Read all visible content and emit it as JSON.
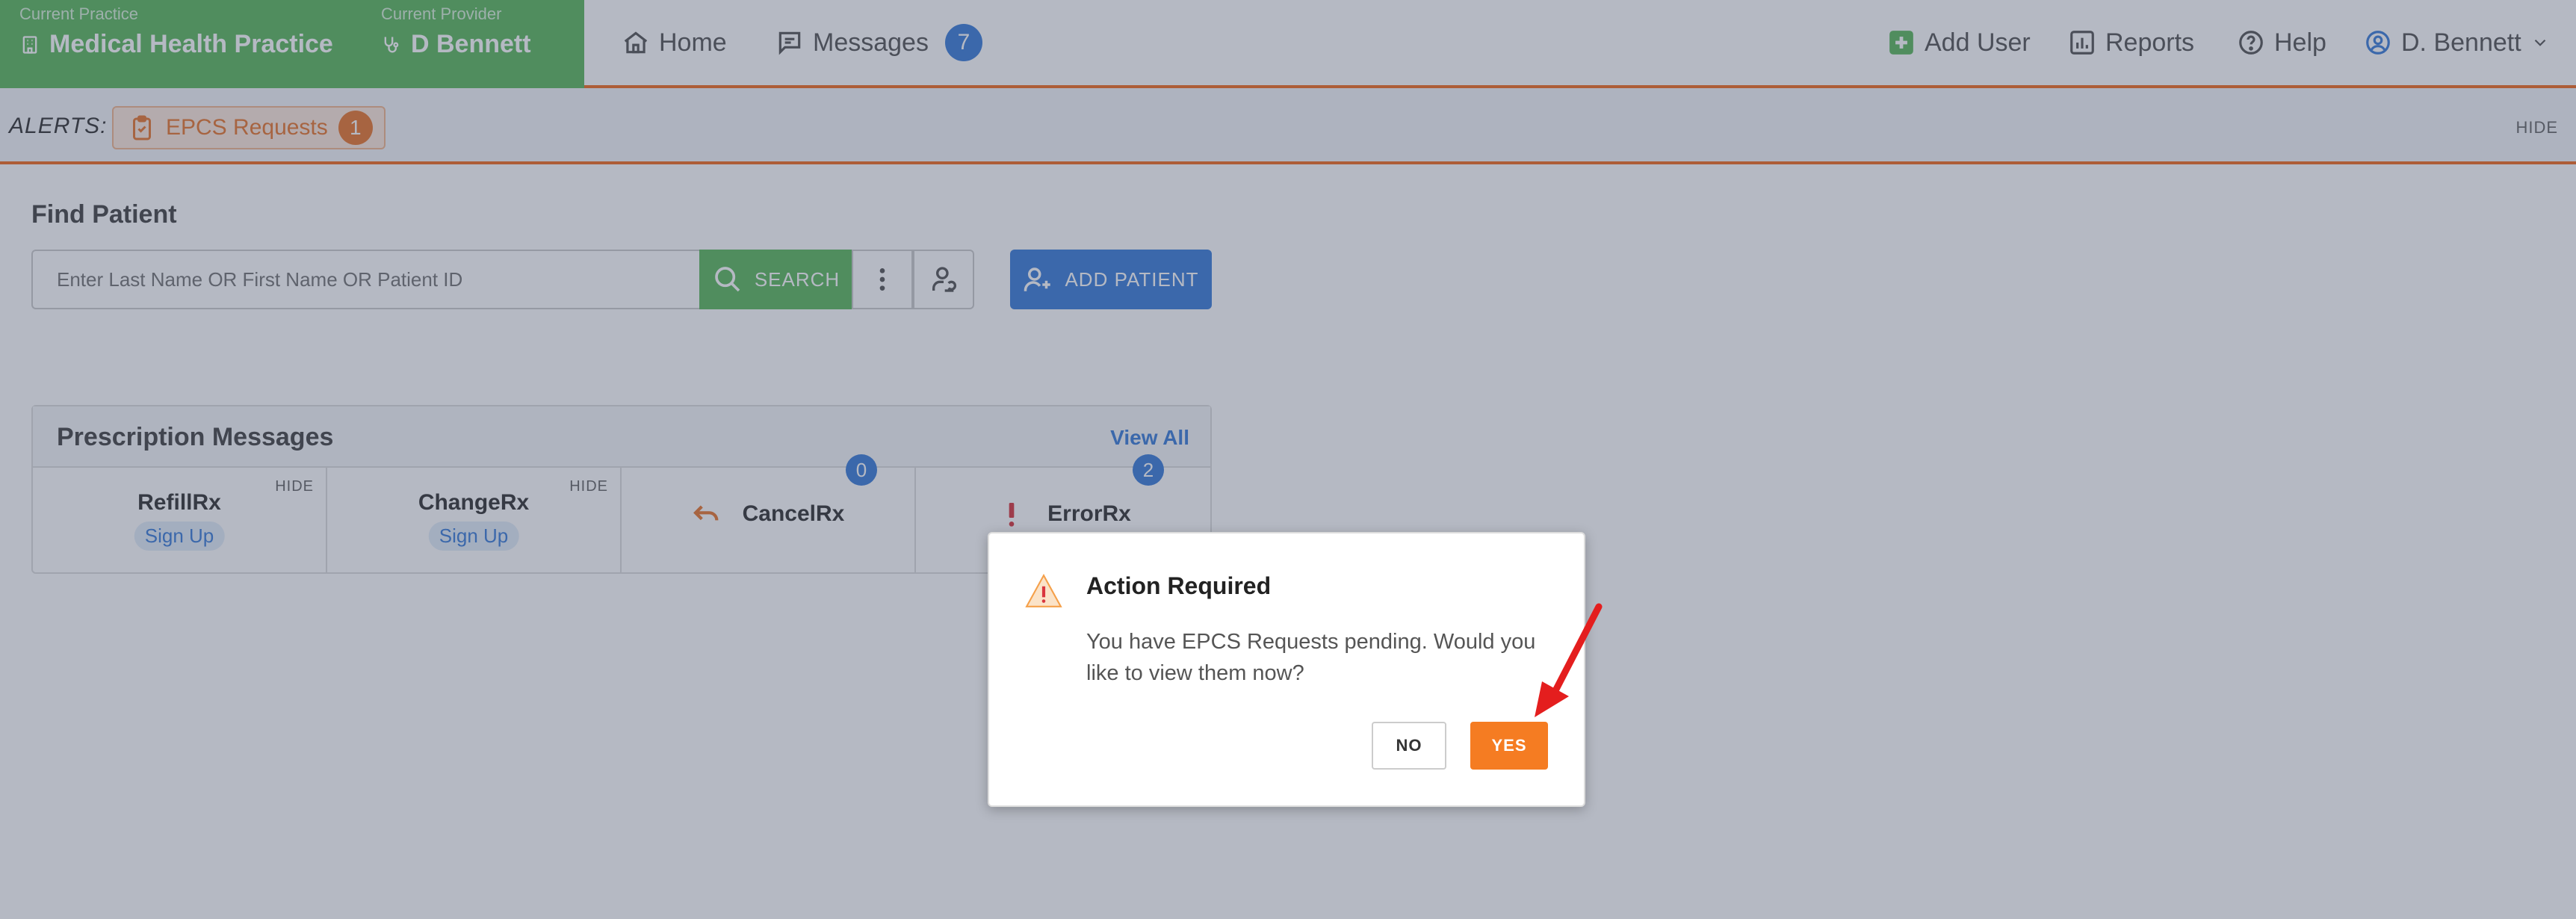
{
  "topnav": {
    "practice_label": "Current Practice",
    "practice_value": "Medical Health Practice",
    "provider_label": "Current Provider",
    "provider_value": "D Bennett",
    "home": "Home",
    "messages": "Messages",
    "messages_count": "7",
    "add_user": "Add User",
    "reports": "Reports",
    "help": "Help",
    "user": "D. Bennett"
  },
  "alerts": {
    "label": "ALERTS:",
    "epcs_label": "EPCS Requests",
    "epcs_count": "1",
    "hide": "HIDE"
  },
  "find_patient": {
    "title": "Find Patient",
    "placeholder": "Enter Last Name OR First Name OR Patient ID",
    "search_label": "SEARCH",
    "add_patient_label": "ADD PATIENT"
  },
  "rx_messages": {
    "title": "Prescription Messages",
    "view_all": "View All",
    "refill": {
      "name": "RefillRx",
      "sub": "Sign Up",
      "hide": "HIDE"
    },
    "change": {
      "name": "ChangeRx",
      "sub": "Sign Up",
      "hide": "HIDE"
    },
    "cancel": {
      "name": "CancelRx",
      "count": "0"
    },
    "error": {
      "name": "ErrorRx",
      "count": "2"
    }
  },
  "modal": {
    "title": "Action Required",
    "body": "You have EPCS Requests pending. Would you like to view them now?",
    "no_label": "NO",
    "yes_label": "YES"
  },
  "colors": {
    "primary_green": "#5cb85c",
    "primary_blue": "#3b7dd8",
    "accent_orange": "#f57c22"
  }
}
